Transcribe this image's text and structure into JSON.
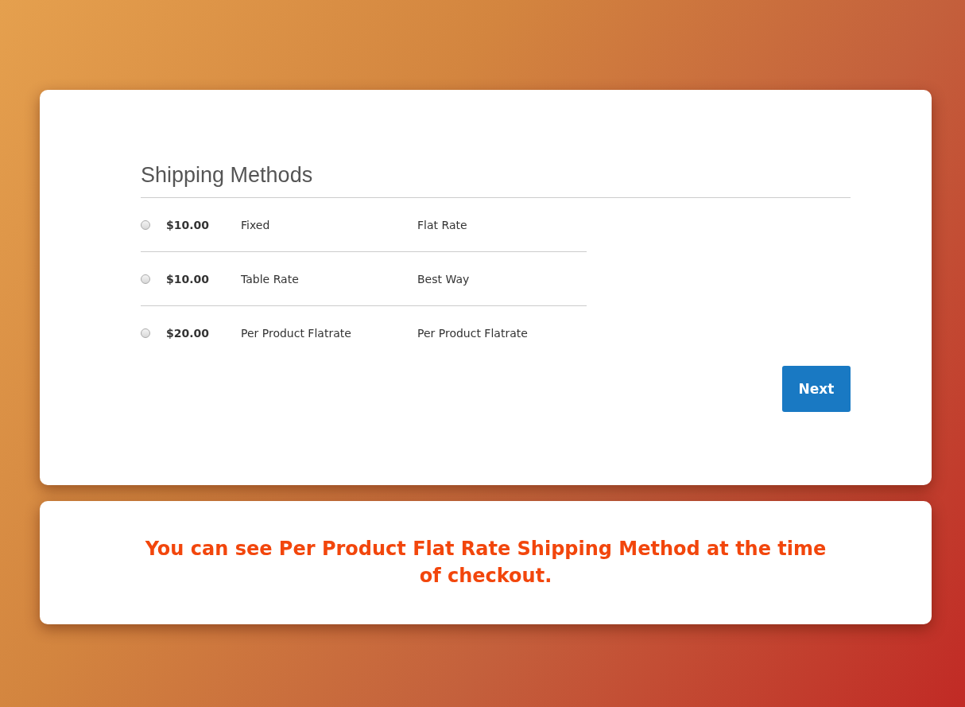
{
  "shipping": {
    "title": "Shipping Methods",
    "methods": [
      {
        "price": "$10.00",
        "method": "Fixed",
        "carrier": "Flat Rate",
        "selected": false
      },
      {
        "price": "$10.00",
        "method": "Table Rate",
        "carrier": "Best Way",
        "selected": false
      },
      {
        "price": "$20.00",
        "method": "Per Product Flatrate",
        "carrier": "Per Product Flatrate",
        "selected": false
      }
    ],
    "button": "Next"
  },
  "caption": "You can see Per Product Flat Rate Shipping Method at the time of checkout."
}
